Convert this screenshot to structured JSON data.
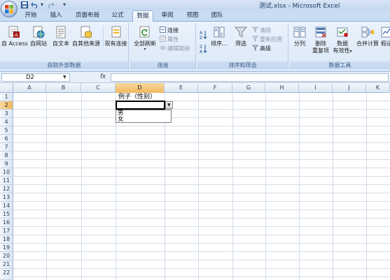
{
  "window": {
    "title": "测试.xlsx - Microsoft Excel",
    "qat": [
      "save-icon",
      "undo-icon",
      "redo-icon",
      "customize-icon"
    ]
  },
  "tabs": [
    {
      "label": "开始"
    },
    {
      "label": "插入"
    },
    {
      "label": "页面布局"
    },
    {
      "label": "公式"
    },
    {
      "label": "数据",
      "active": true
    },
    {
      "label": "审阅"
    },
    {
      "label": "视图"
    },
    {
      "label": "团队"
    }
  ],
  "ribbon": {
    "groups": {
      "external": {
        "label": "获取外部数据",
        "buttons": [
          "自 Access",
          "自网站",
          "自文本",
          "自其他来源",
          "现有连接"
        ]
      },
      "connections": {
        "label": "连接",
        "refresh_all": "全部刷新",
        "small": [
          "连接",
          "属性",
          "编辑链接"
        ]
      },
      "sort_filter": {
        "label": "排序和筛选",
        "sort": "排序...",
        "filter": "筛选",
        "small": [
          "清除",
          "重新应用",
          "高级"
        ]
      },
      "data_tools": {
        "label": "数据工具",
        "split": "分列",
        "remove_dup_1": "删除",
        "remove_dup_2": "重复项",
        "validation_1": "数据",
        "validation_2": "有效性",
        "consolidate": "合并计算",
        "whatif": "假设"
      }
    }
  },
  "formula_bar": {
    "name_box": "D2",
    "fx": "fx",
    "value": ""
  },
  "sheet": {
    "columns": [
      "A",
      "B",
      "C",
      "D",
      "E",
      "F",
      "G",
      "H",
      "I",
      "J",
      "K"
    ],
    "selected_column": "D",
    "rows": [
      "1",
      "2",
      "3",
      "4",
      "5",
      "6",
      "7",
      "8",
      "9",
      "10",
      "11",
      "12",
      "13",
      "14",
      "15",
      "16",
      "17",
      "18",
      "19",
      "20",
      "21",
      "22"
    ],
    "selected_row": "2",
    "cells": {
      "D1": "例子（性别）",
      "D2": ""
    },
    "dropdown": {
      "options": [
        "男",
        "女"
      ]
    }
  },
  "colors": {
    "ribbon_bg": "#dbe8f7",
    "selected_header": "#f1b75e",
    "gridline": "#d4dde8"
  }
}
